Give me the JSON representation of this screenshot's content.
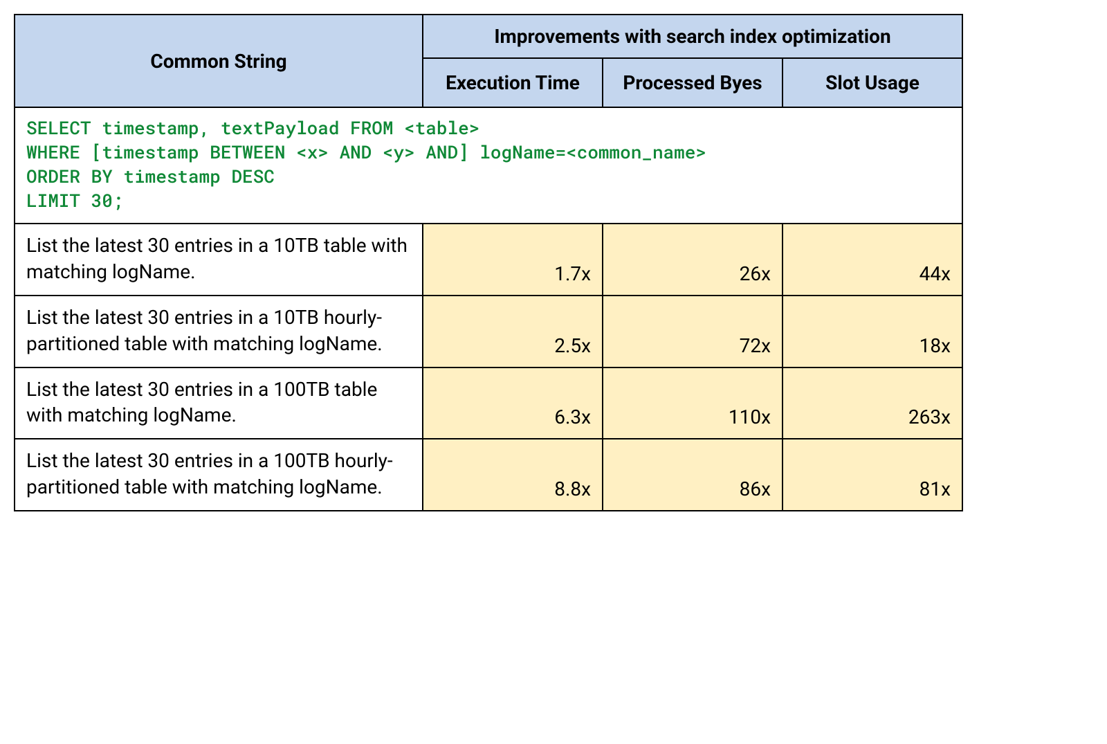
{
  "headers": {
    "common_string": "Common String",
    "group_title": "Improvements with search index optimization",
    "execution_time": "Execution Time",
    "processed_bytes": "Processed Byes",
    "slot_usage": "Slot Usage"
  },
  "sql": "SELECT timestamp, textPayload FROM <table>\nWHERE [timestamp BETWEEN <x> AND <y> AND] logName=<common_name>\nORDER BY timestamp DESC\nLIMIT 30;",
  "rows": [
    {
      "description": "List the latest 30 entries in a 10TB table with matching logName.",
      "execution_time": "1.7x",
      "processed_bytes": "26x",
      "slot_usage": "44x"
    },
    {
      "description": "List the latest 30 entries in a 10TB hourly-partitioned table with matching logName.",
      "execution_time": "2.5x",
      "processed_bytes": "72x",
      "slot_usage": "18x"
    },
    {
      "description": "List the latest 30 entries in a 100TB table with matching logName.",
      "execution_time": "6.3x",
      "processed_bytes": "110x",
      "slot_usage": "263x"
    },
    {
      "description": "List the latest 30 entries in a 100TB hourly-partitioned table with matching logName.",
      "execution_time": "8.8x",
      "processed_bytes": "86x",
      "slot_usage": "81x"
    }
  ],
  "chart_data": {
    "type": "table",
    "title": "Improvements with search index optimization",
    "columns": [
      "Common String",
      "Execution Time",
      "Processed Byes",
      "Slot Usage"
    ],
    "rows": [
      [
        "List the latest 30 entries in a 10TB table with matching logName.",
        "1.7x",
        "26x",
        "44x"
      ],
      [
        "List the latest 30 entries in a 10TB hourly-partitioned table with matching logName.",
        "2.5x",
        "72x",
        "18x"
      ],
      [
        "List the latest 30 entries in a 100TB table with matching logName.",
        "6.3x",
        "110x",
        "263x"
      ],
      [
        "List the latest 30 entries in a 100TB hourly-partitioned table with matching logName.",
        "8.8x",
        "86x",
        "81x"
      ]
    ]
  }
}
